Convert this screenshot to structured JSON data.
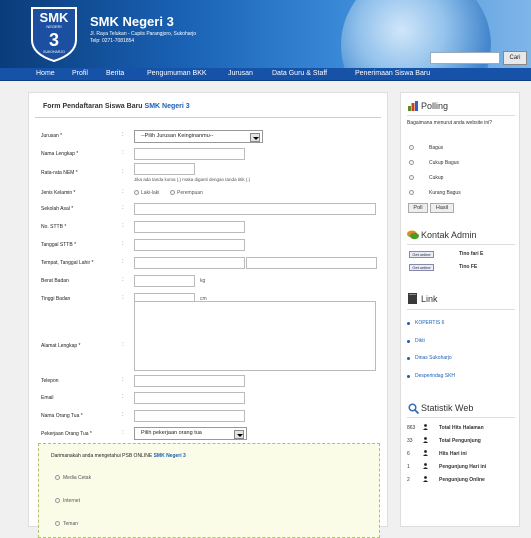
{
  "header": {
    "site_name": "SMK Negeri 3",
    "address_line1": "Jl. Raya Telukan - Cupiis Parangjoro, Sukoharjo",
    "address_line2": "Telp: 0271-7081854",
    "logo_text": "SMK",
    "logo_sub": "NEGERI",
    "logo_num": "3",
    "logo_city": "SUKOHARJO",
    "search_button": "Cari",
    "search_value": ""
  },
  "nav": [
    "Home",
    "Profil",
    "Berita",
    "Pengumuman BKK",
    "Jurusan",
    "Data Guru & Staff",
    "Penerimaan Siswa Baru"
  ],
  "form": {
    "title_prefix": "Form Pendaftaran Siswa Baru",
    "title_school": "SMK Negeri 3",
    "jurusan_label": "Jurusan *",
    "jurusan_value": "--Pilih Jurusan Keinginanmu--",
    "nama_label": "Nama Lengkap *",
    "nem_label": "Rata-rata NEM *",
    "nem_hint": "Jika ada tanda koma (,) maka diganti dengan tanda titik (.)",
    "jk_label": "Jenis Kelamin *",
    "jk_options": [
      "Laki-laki",
      "Perempuan"
    ],
    "sekolah_label": "Sekolah Asal *",
    "sttb_label": "No. STTB *",
    "tgl_sttb_label": "Tanggal STTB *",
    "ttl_label": "Tempat, Tanggal Lahir *",
    "berat_label": "Berat Badan",
    "berat_unit": "kg",
    "tinggi_label": "Tinggi Badan",
    "tinggi_unit": "cm",
    "alamat_label": "Alamat Lengkap *",
    "telepon_label": "Telepon",
    "email_label": "Email",
    "ortu_label": "Nama Orang Tua *",
    "pekerjaan_label": "Pekerjaan Orang Tua *",
    "pekerjaan_value": "Pilih pekerjaan orang tua",
    "source_question": "Darimanakah anda mengetahui PSB ONLINE",
    "source_school": "SMK Negeri 3",
    "source_options": [
      "Media Cetak",
      "Internet",
      "Teman"
    ],
    "colon": ":"
  },
  "sidebar": {
    "polling_title": "Polling",
    "polling_question": "Bagaimana menurut anda website ini?",
    "polling_options": [
      "Bagus",
      "Cukup Bagus",
      "Cukup",
      "Kurang Bagus"
    ],
    "poll_btn": "Poll",
    "hasil_btn": "Hasil",
    "kontak_title": "Kontak Admin",
    "badge": "Get online",
    "admins": [
      "Tino fari E",
      "Tino FE"
    ],
    "link_title": "Link",
    "links": [
      "KOPERTIS 6",
      "Dikti",
      "Dinas Sukoharjo",
      "Desperindag SKH"
    ],
    "stat_title": "Statistik Web",
    "stats": [
      {
        "num": "863",
        "label": "Total Hits Halaman"
      },
      {
        "num": "33",
        "label": "Total Pengunjung"
      },
      {
        "num": "6",
        "label": "Hits Hari ini"
      },
      {
        "num": "1",
        "label": "Pengunjung Hari ini"
      },
      {
        "num": "2",
        "label": "Pengunjung Online"
      }
    ]
  }
}
